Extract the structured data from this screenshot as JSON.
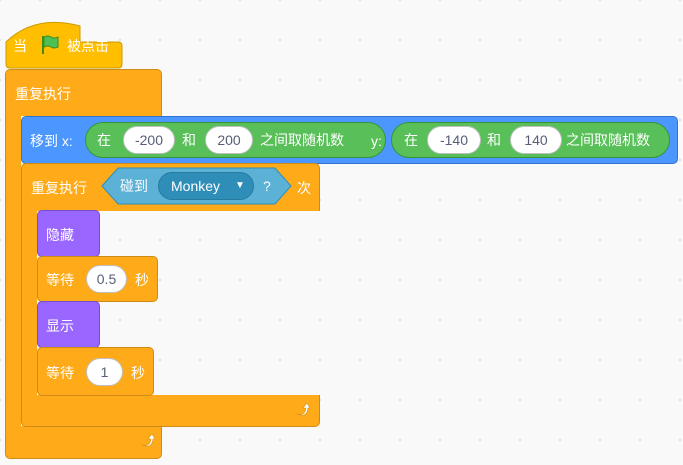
{
  "hat_block": {
    "prefix": "当",
    "flag_icon": "green-flag-icon",
    "suffix": "被点击"
  },
  "outer_loop": {
    "label": "重复执行",
    "loop_icon": "loop-arrow-icon"
  },
  "motion_block": {
    "label": "移到 x:",
    "y_label": "y:",
    "random_x": {
      "prefix": "在",
      "from": "-200",
      "and": "和",
      "to": "200",
      "suffix": "之间取随机数"
    },
    "random_y": {
      "prefix": "在",
      "from": "-140",
      "and": "和",
      "to": "140",
      "suffix": "之间取随机数"
    }
  },
  "repeat_until": {
    "label": "重复执行",
    "sensing_label": "碰到",
    "target": "Monkey",
    "question": "?",
    "suffix": "次",
    "loop_icon": "loop-arrow-icon"
  },
  "inner_blocks": {
    "hide_label": "隐藏",
    "wait1": {
      "label": "等待",
      "value": "0.5",
      "unit": "秒"
    },
    "show_label": "显示",
    "wait2": {
      "label": "等待",
      "value": "1",
      "unit": "秒"
    }
  },
  "colors": {
    "control": "#ffab19",
    "motion": "#4c97ff",
    "operators": "#59c059",
    "looks": "#9966ff",
    "sensing": "#5cb1d6"
  }
}
